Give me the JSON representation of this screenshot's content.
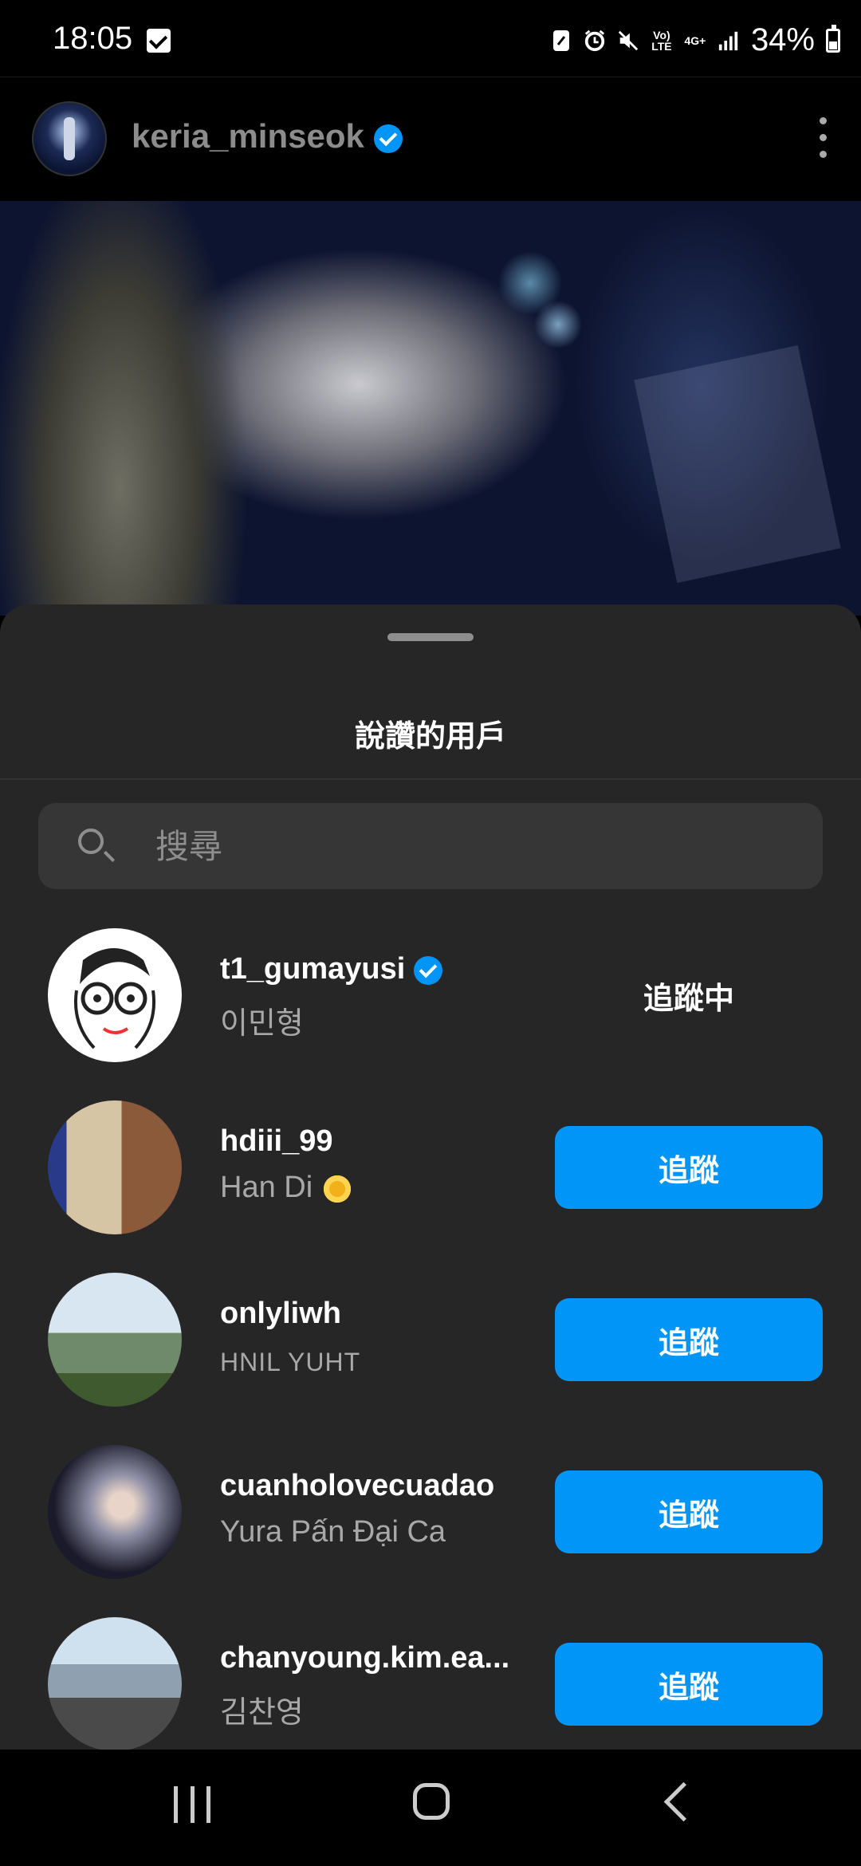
{
  "status_bar": {
    "time": "18:05",
    "network": "Vo) LTE",
    "network_type": "4G+",
    "battery": "34%",
    "icons": [
      "check-box-icon",
      "nfc-icon",
      "alarm-icon",
      "mute-icon",
      "volte-icon",
      "4g-icon",
      "signal-icon",
      "battery-icon"
    ]
  },
  "post": {
    "username": "keria_minseok",
    "verified": true
  },
  "sheet": {
    "title": "說讚的用戶",
    "search_placeholder": "搜尋"
  },
  "users": [
    {
      "username": "t1_gumayusi",
      "subtitle": "이민형",
      "verified": true,
      "button": "追蹤中",
      "following": true
    },
    {
      "username": "hdiii_99",
      "subtitle": "Han Di",
      "emoji": "sunflower",
      "verified": false,
      "button": "追蹤",
      "following": false
    },
    {
      "username": "onlyliwh",
      "subtitle": "HNIL YUHT",
      "verified": false,
      "button": "追蹤",
      "following": false
    },
    {
      "username": "cuanholovecuadao",
      "subtitle": "Yura Pấn Đại Ca",
      "verified": false,
      "button": "追蹤",
      "following": false
    },
    {
      "username": "chanyoung.kim.ea...",
      "subtitle": "김찬영",
      "verified": false,
      "button": "追蹤",
      "following": false
    }
  ],
  "colors": {
    "accent": "#0095f6",
    "sheet_bg": "#262626",
    "search_bg": "#363636"
  }
}
